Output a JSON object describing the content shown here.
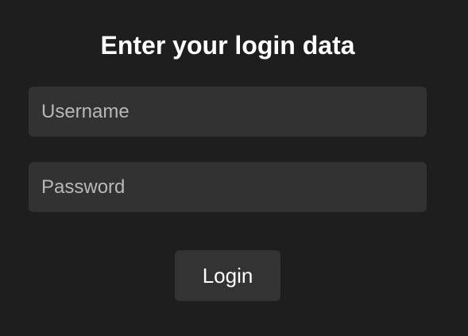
{
  "form": {
    "title": "Enter your login data",
    "username": {
      "value": "",
      "placeholder": "Username"
    },
    "password": {
      "value": "",
      "placeholder": "Password"
    },
    "submit_label": "Login"
  },
  "colors": {
    "background": "#1e1e1e",
    "input_background": "#323232",
    "button_background": "#333333",
    "text": "#ffffff",
    "placeholder": "#b8b8b8"
  }
}
